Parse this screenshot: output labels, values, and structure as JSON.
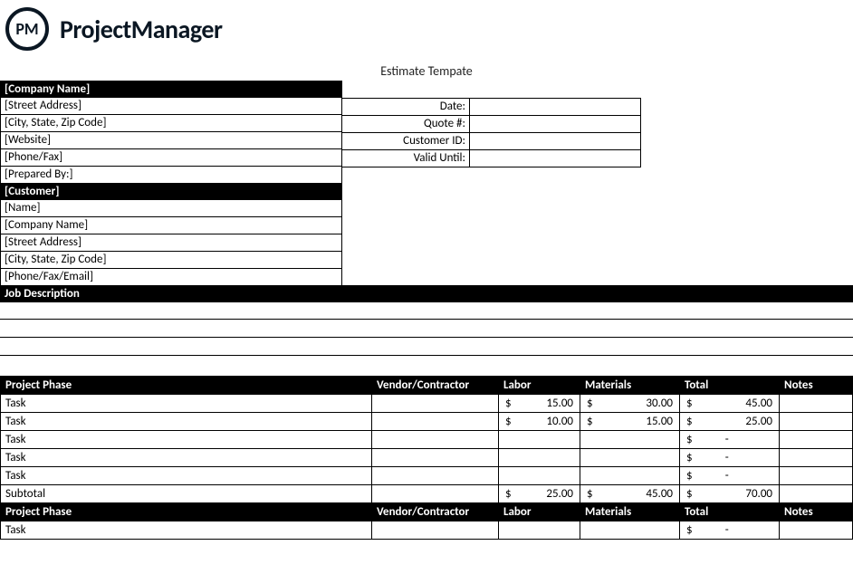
{
  "brand": {
    "icon_text": "PM",
    "word": "ProjectManager"
  },
  "doc_title": "Estimate Tempate",
  "company": {
    "header": "[Company Name]",
    "rows": [
      "[Street Address]",
      "[City, State, Zip Code]",
      "[Website]",
      "[Phone/Fax]",
      "[Prepared By:]"
    ]
  },
  "meta": {
    "labels": [
      "Date:",
      "Quote #:",
      "Customer ID:",
      "Valid Until:"
    ],
    "values": [
      "",
      "",
      "",
      ""
    ]
  },
  "customer": {
    "header": "[Customer]",
    "rows": [
      "[Name]",
      "[Company Name]",
      "[Street Address]",
      "[City, State, Zip Code]",
      "[Phone/Fax/Email]"
    ]
  },
  "job_description": {
    "header": "Job Description",
    "lines": [
      "",
      "",
      ""
    ]
  },
  "task_headers": {
    "phase": "Project Phase",
    "vendor": "Vendor/Contractor",
    "labor": "Labor",
    "materials": "Materials",
    "total": "Total",
    "notes": "Notes"
  },
  "phase1": {
    "rows": [
      {
        "phase": "Task",
        "vendor": "",
        "labor": "15.00",
        "materials": "30.00",
        "total": "45.00",
        "notes": ""
      },
      {
        "phase": "Task",
        "vendor": "",
        "labor": "10.00",
        "materials": "15.00",
        "total": "25.00",
        "notes": ""
      },
      {
        "phase": "Task",
        "vendor": "",
        "labor": "",
        "materials": "",
        "total": "-",
        "notes": ""
      },
      {
        "phase": "Task",
        "vendor": "",
        "labor": "",
        "materials": "",
        "total": "-",
        "notes": ""
      },
      {
        "phase": "Task",
        "vendor": "",
        "labor": "",
        "materials": "",
        "total": "-",
        "notes": ""
      }
    ],
    "subtotal": {
      "label": "Subtotal",
      "labor": "25.00",
      "materials": "45.00",
      "total": "70.00"
    }
  },
  "phase2": {
    "rows": [
      {
        "phase": "Task",
        "vendor": "",
        "labor": "",
        "materials": "",
        "total": "-",
        "notes": ""
      }
    ]
  },
  "currency": "$"
}
